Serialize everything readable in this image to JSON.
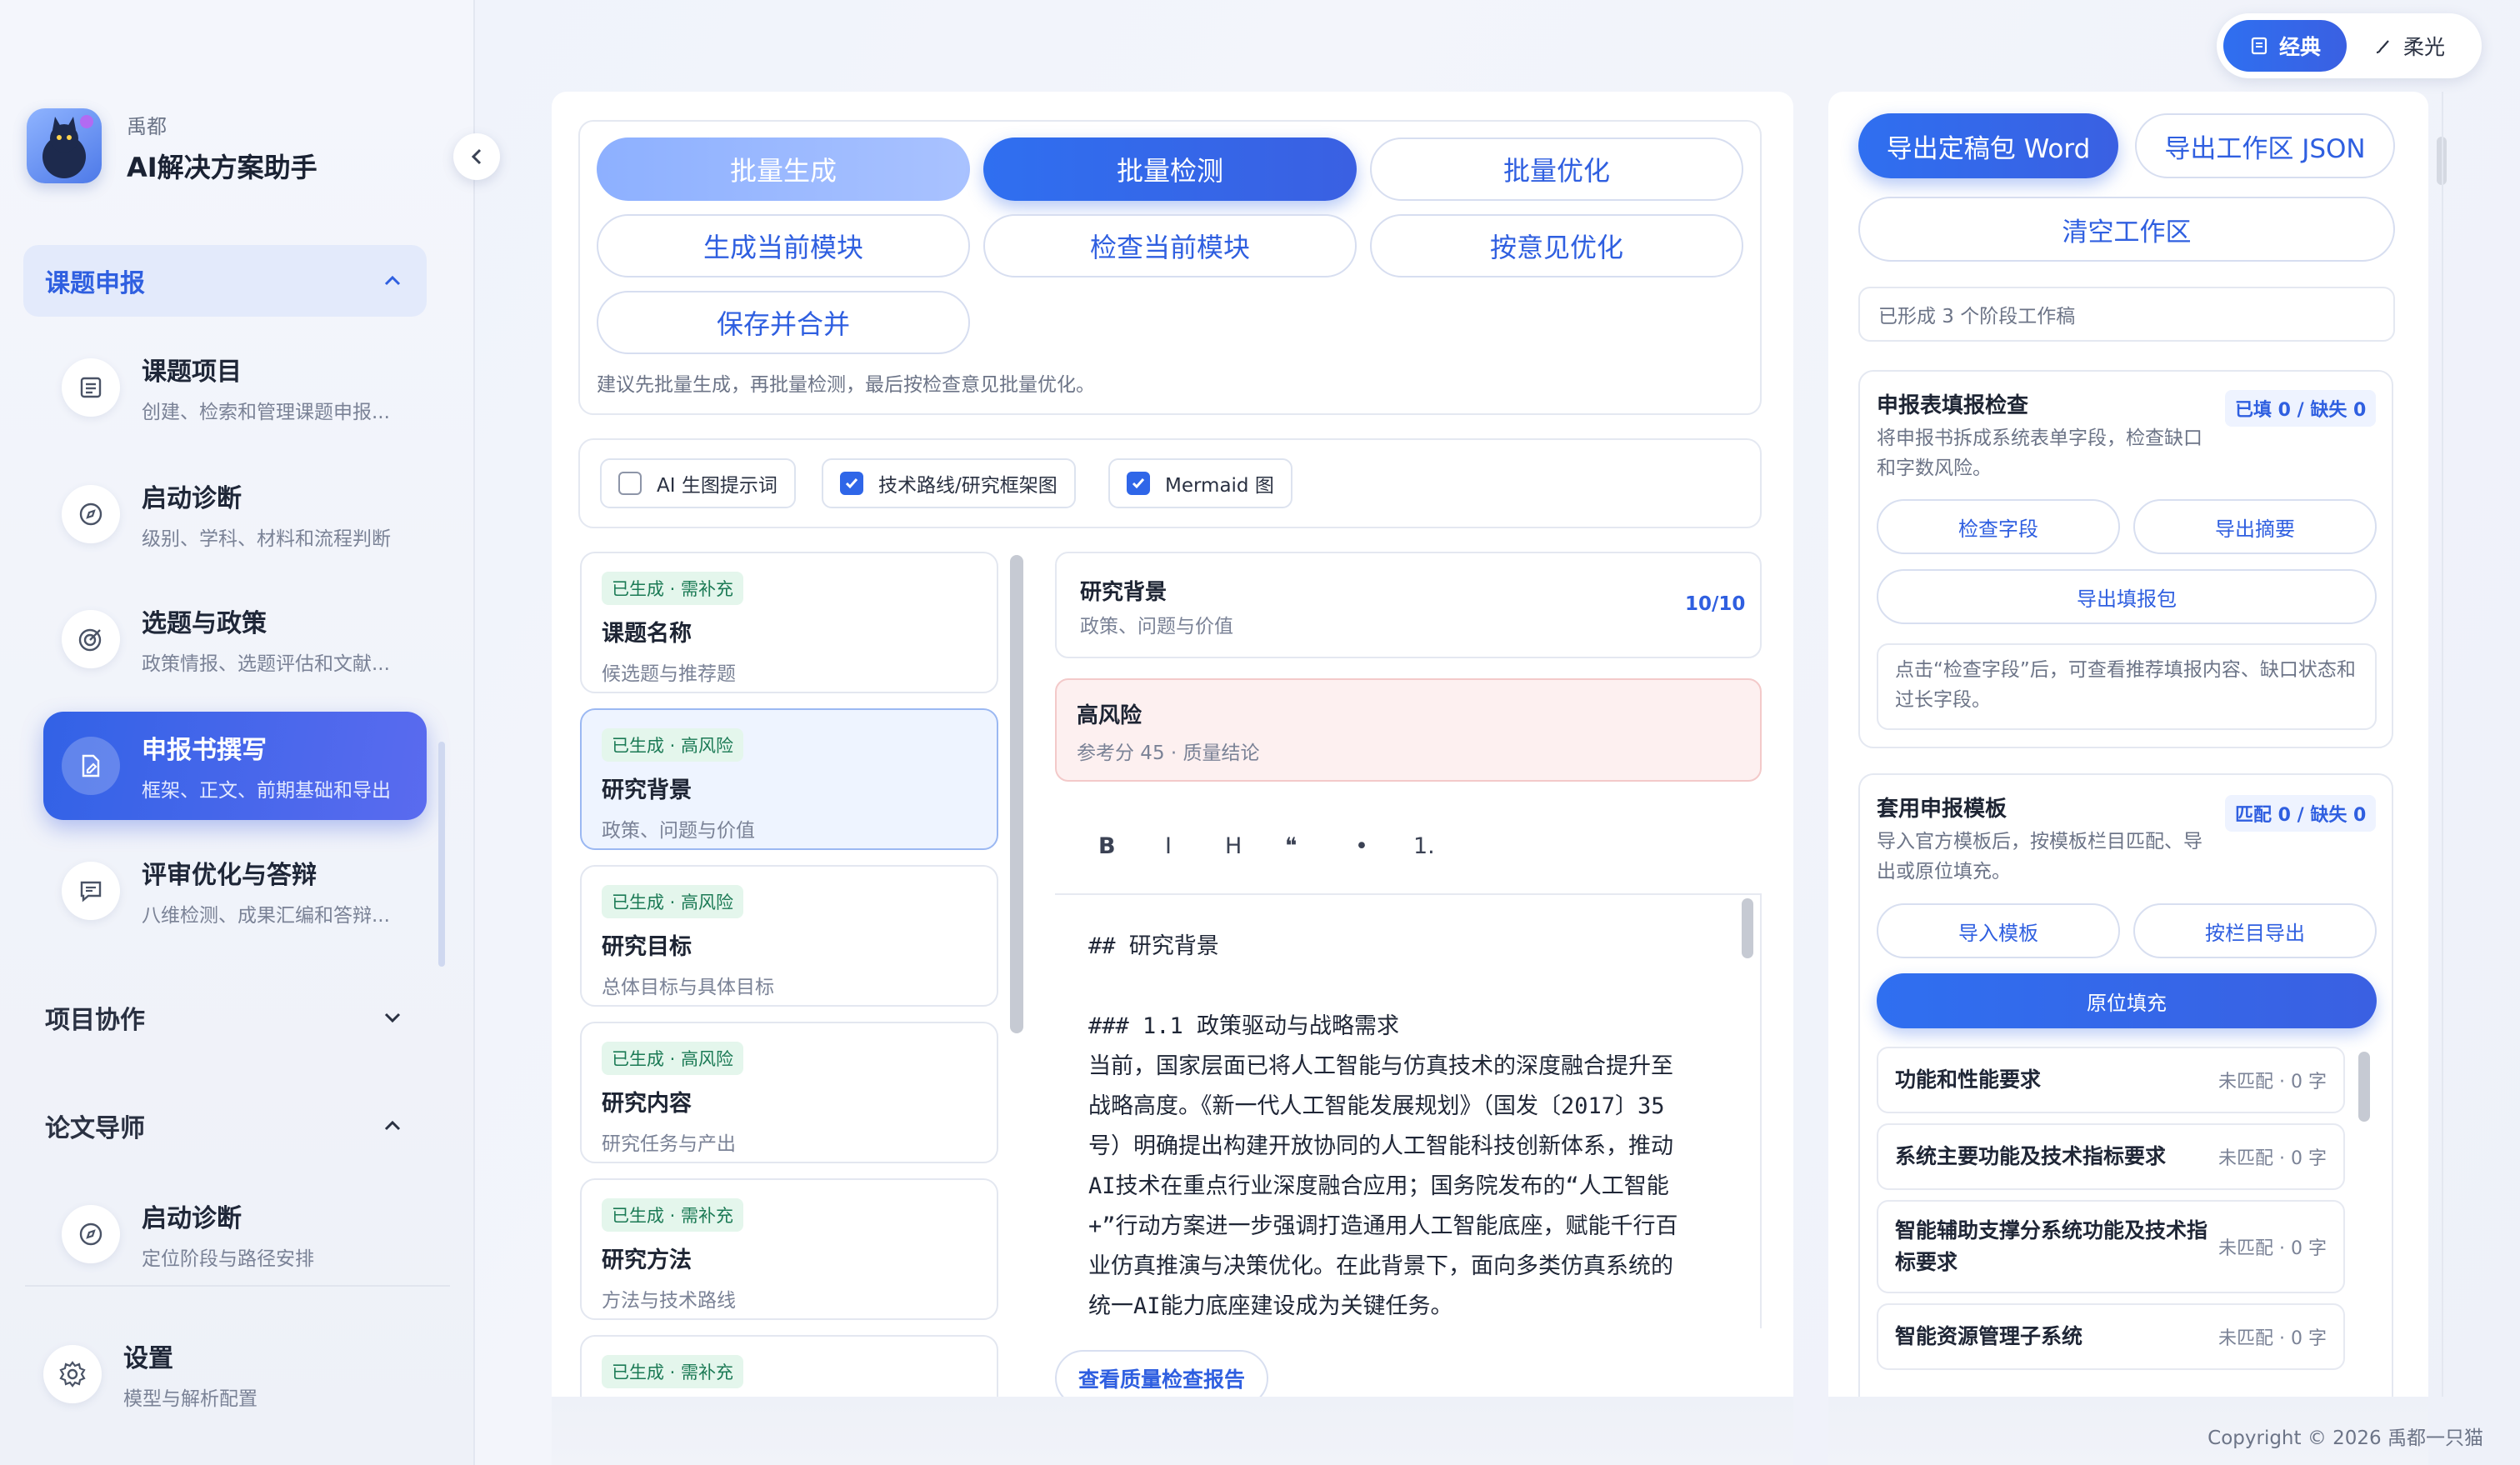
{
  "window": {
    "traffic_colors": [
      "#ff5f57",
      "#febc2e",
      "#28c840"
    ]
  },
  "brand": {
    "subtitle": "禹都",
    "title": "AI解决方案助手"
  },
  "mode_switch": {
    "classic": "经典",
    "soft": "柔光"
  },
  "sidebar": {
    "groups": [
      {
        "label": "课题申报",
        "items": [
          {
            "title": "课题项目",
            "desc": "创建、检索和管理课题申报..."
          },
          {
            "title": "启动诊断",
            "desc": "级别、学科、材料和流程判断"
          },
          {
            "title": "选题与政策",
            "desc": "政策情报、选题评估和文献..."
          },
          {
            "title": "申报书撰写",
            "desc": "框架、正文、前期基础和导出"
          },
          {
            "title": "评审优化与答辩",
            "desc": "八维检测、成果汇编和答辩..."
          }
        ]
      },
      {
        "label": "项目协作"
      },
      {
        "label": "论文导师",
        "items": [
          {
            "title": "启动诊断",
            "desc": "定位阶段与路径安排"
          }
        ]
      }
    ],
    "settings": {
      "title": "设置",
      "desc": "模型与解析配置"
    }
  },
  "batch": {
    "buttons": [
      "批量生成",
      "批量检测",
      "批量优化",
      "生成当前模块",
      "检查当前模块",
      "按意见优化",
      "保存并合并"
    ],
    "hint": "建议先批量生成，再批量检测，最后按检查意见批量优化。"
  },
  "options": [
    {
      "label": "AI 生图提示词",
      "checked": false
    },
    {
      "label": "技术路线/研究框架图",
      "checked": true
    },
    {
      "label": "Mermaid 图",
      "checked": true
    }
  ],
  "modules": [
    {
      "badge": "已生成 · 需补充",
      "title": "课题名称",
      "desc": "候选题与推荐题"
    },
    {
      "badge": "已生成 · 高风险",
      "title": "研究背景",
      "desc": "政策、问题与价值"
    },
    {
      "badge": "已生成 · 高风险",
      "title": "研究目标",
      "desc": "总体目标与具体目标"
    },
    {
      "badge": "已生成 · 高风险",
      "title": "研究内容",
      "desc": "研究任务与产出"
    },
    {
      "badge": "已生成 · 需补充",
      "title": "研究方法",
      "desc": "方法与技术路线"
    },
    {
      "badge": "已生成 · 需补充"
    }
  ],
  "editor": {
    "header_title": "研究背景",
    "header_desc": "政策、问题与价值",
    "count": "10/10",
    "risk_title": "高风险",
    "risk_desc": "参考分 45 · 质量结论",
    "toolbar": [
      "B",
      "I",
      "H",
      "❝",
      "•",
      "1."
    ],
    "content": "## 研究背景\n\n### 1.1 政策驱动与战略需求\n当前，国家层面已将人工智能与仿真技术的深度融合提升至\n战略高度。《新一代人工智能发展规划》（国发〔2017〕35\n号）明确提出构建开放协同的人工智能科技创新体系，推动\nAI技术在重点行业深度融合应用；国务院发布的“人工智能\n+”行动方案进一步强调打造通用人工智能底座，赋能千行百\n业仿真推演与决策优化。在此背景下，面向多类仿真系统的\n统一AI能力底座建设成为关键任务。",
    "report_button": "查看质量检查报告"
  },
  "right": {
    "export_word": "导出定稿包 Word",
    "export_json": "导出工作区 JSON",
    "clear": "清空工作区",
    "status": "已形成 3 个阶段工作稿",
    "form_check": {
      "title": "申报表填报检查",
      "tag": "已填 0 / 缺失 0",
      "desc": "将申报书拆成系统表单字段，检查缺口和字数风险。",
      "btn_check": "检查字段",
      "btn_export": "导出摘要",
      "btn_pack": "导出填报包",
      "note": "点击“检查字段”后，可查看推荐填报内容、缺口状态和过长字段。"
    },
    "template": {
      "title": "套用申报模板",
      "tag": "匹配 0 / 缺失 0",
      "desc": "导入官方模板后，按模板栏目匹配、导出或原位填充。",
      "btn_import": "导入模板",
      "btn_export": "按栏目导出",
      "btn_fill": "原位填充",
      "fields": [
        {
          "name": "功能和性能要求",
          "status": "未匹配 · 0 字"
        },
        {
          "name": "系统主要功能及技术指标要求",
          "status": "未匹配 · 0 字"
        },
        {
          "name": "智能辅助支撑分系统功能及技术指标要求",
          "status": "未匹配 · 0 字"
        },
        {
          "name": "智能资源管理子系统",
          "status": "未匹配 · 0 字"
        }
      ]
    }
  },
  "footer": {
    "copyright": "Copyright © 2026 禹都一只猫"
  },
  "colors": {
    "accent": "#2f66e8",
    "risk_bg": "#fdf0f0",
    "badge_green": "#1b7a55"
  }
}
